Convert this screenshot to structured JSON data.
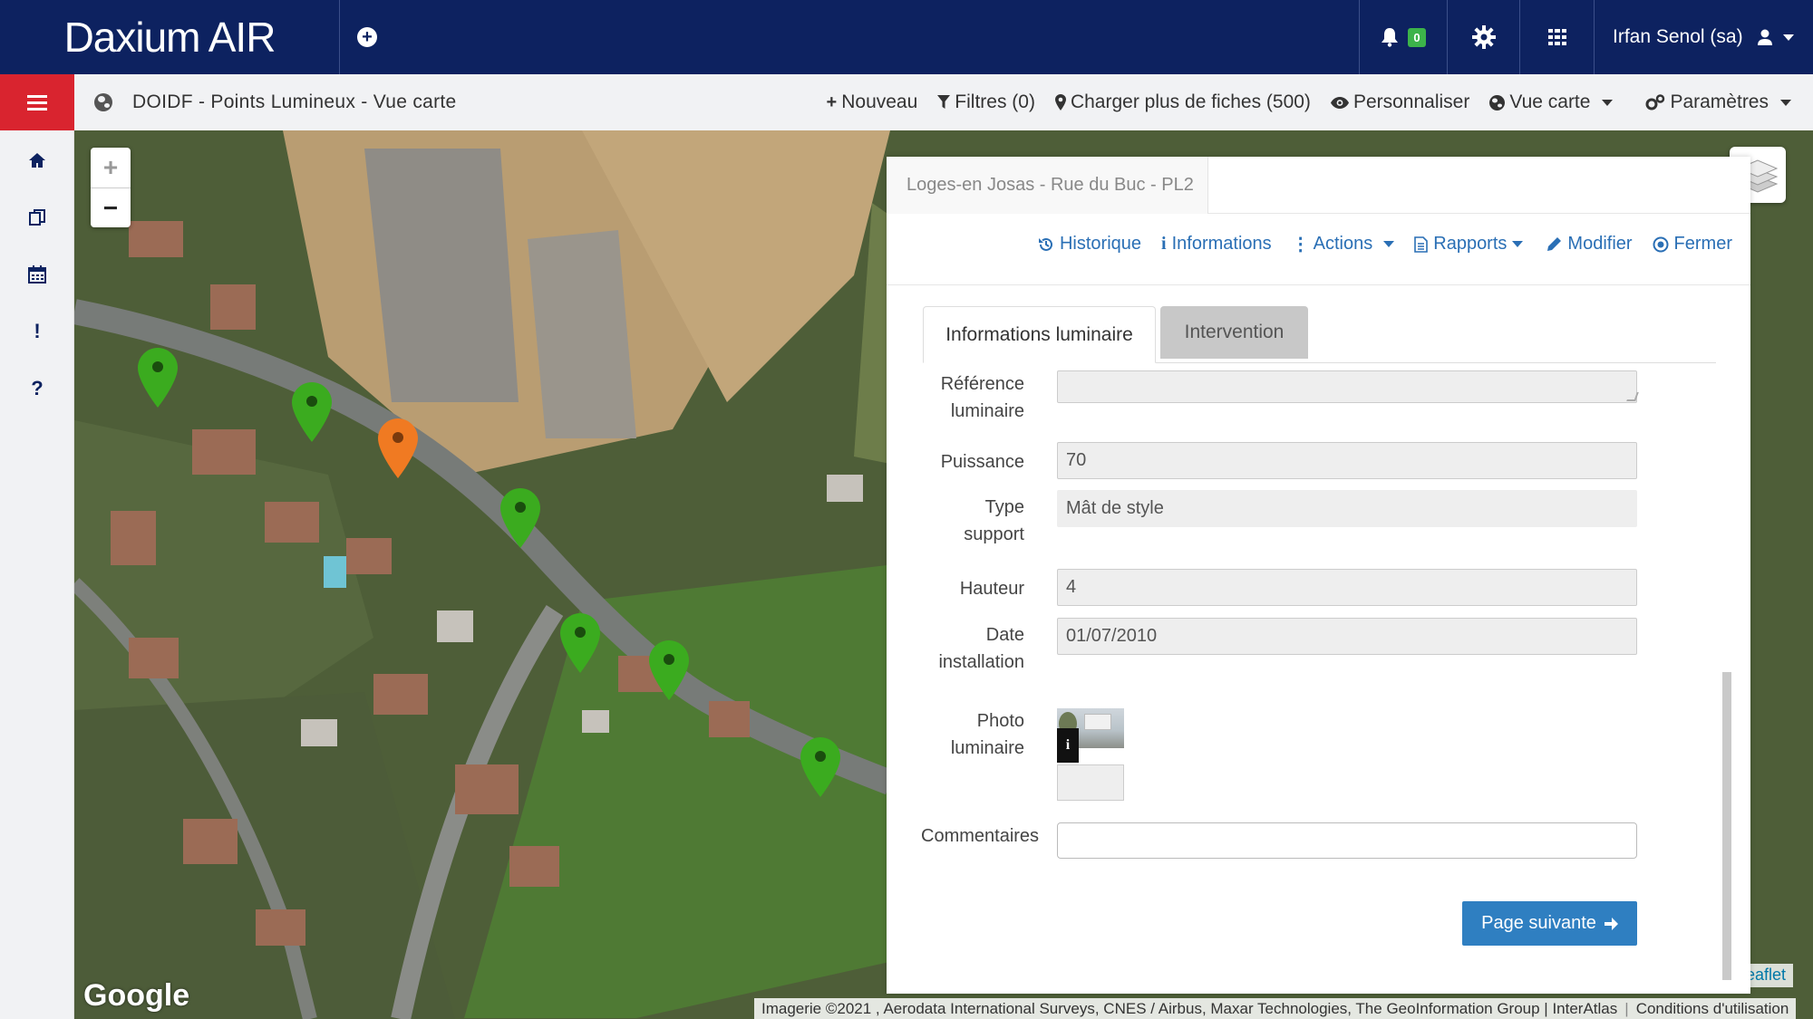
{
  "app": {
    "logo": "Daxium AIR"
  },
  "topbar": {
    "notif_count": "0",
    "user_name": "Irfan Senol (sa)"
  },
  "subbar": {
    "title": "DOIDF - Points Lumineux - Vue carte",
    "actions": {
      "new": "Nouveau",
      "filters": "Filtres (0)",
      "load_more": "Charger plus de fiches (500)",
      "customize": "Personnaliser",
      "view": "Vue carte",
      "settings": "Paramètres"
    }
  },
  "map": {
    "zoom_in": "+",
    "zoom_out": "−",
    "google_logo": "Google",
    "attribution": "Imagerie ©2021 , Aerodata International Surveys, CNES / Airbus, Maxar Technologies, The GeoInformation Group | InterAtlas",
    "terms": "Conditions d'utilisation",
    "leaflet": "Leaflet",
    "colors": {
      "marker_ok": "#3bab1f",
      "marker_warn": "#f07a22"
    }
  },
  "panel": {
    "title": "Loges-en Josas - Rue du Buc - PL2",
    "actions": {
      "history": "Historique",
      "info": "Informations",
      "actions": "Actions",
      "reports": "Rapports",
      "edit": "Modifier",
      "close": "Fermer"
    },
    "tabs": {
      "active": "Informations luminaire",
      "inactive": "Intervention"
    },
    "fields": {
      "reference": {
        "label_l1": "Référence",
        "label_l2": "luminaire",
        "value": ""
      },
      "power": {
        "label": "Puissance",
        "value": "70"
      },
      "support": {
        "label_l1": "Type",
        "label_l2": "support",
        "value": "Mât de style"
      },
      "height": {
        "label": "Hauteur",
        "value": "4"
      },
      "install_date": {
        "label_l1": "Date",
        "label_l2": "installation",
        "value": "01/07/2010"
      },
      "photo": {
        "label_l1": "Photo",
        "label_l2": "luminaire",
        "info": "i"
      },
      "comments": {
        "label": "Commentaires",
        "value": ""
      }
    },
    "next_button": "Page suivante"
  }
}
